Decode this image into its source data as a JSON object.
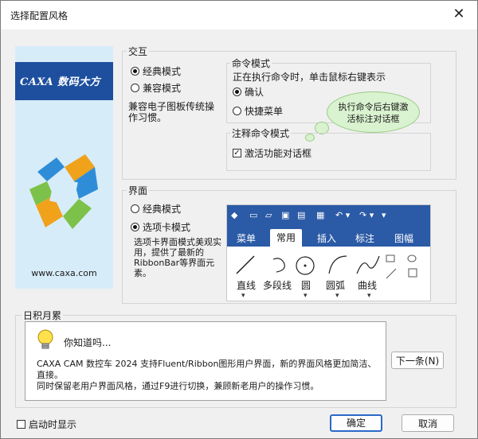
{
  "window": {
    "title": "选择配置风格",
    "close_glyph": "✕"
  },
  "side": {
    "brand": "CAXA 数码大方",
    "site": "www.caxa.com"
  },
  "interaction": {
    "label": "交互",
    "classic": "经典模式",
    "compatible": "兼容模式",
    "description": "兼容电子图板传统操作习惯。"
  },
  "command_mode": {
    "label": "命令模式",
    "description": "正在执行命令时，单击鼠标右键表示",
    "confirm": "确认",
    "shortcut_menu": "快捷菜单"
  },
  "bubble": {
    "text": "执行命令后右键激活标注对话框"
  },
  "annotation_mode": {
    "label": "注释命令模式",
    "activate_dialog": "激活功能对话框"
  },
  "interface": {
    "label": "界面",
    "classic": "经典模式",
    "tab_mode": "选项卡模式",
    "description": "选项卡界面模式美观实用，提供了最新的RibbonBar等界面元素。"
  },
  "ribbon": {
    "tabs": [
      "菜单",
      "常用",
      "插入",
      "标注",
      "图幅"
    ],
    "active_tab": "常用",
    "tools": [
      "直线",
      "多段线",
      "圆",
      "圆弧",
      "曲线"
    ]
  },
  "tips": {
    "label": "日积月累",
    "heading": "你知道吗...",
    "body_line1": "CAXA CAM 数控车 2024 支持Fluent/Ribbon图形用户界面，新的界面风格更加简洁、直接。",
    "body_line2": "同时保留老用户界面风格，通过F9进行切换，兼顾新老用户的操作习惯。",
    "next_button": "下一条(N)"
  },
  "footer": {
    "show_on_startup": "启动时显示",
    "ok": "确定",
    "cancel": "取消"
  },
  "colors": {
    "accent": "#2b5aa6",
    "ribbon_bg": "#2b5aa6",
    "bubble": "#d9f2cf"
  }
}
